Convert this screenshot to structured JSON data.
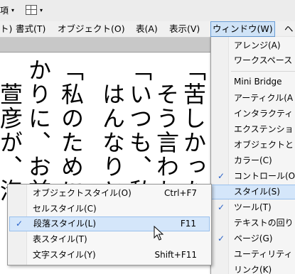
{
  "toolbar": {
    "left_glyph": "項",
    "left_caret": "▾",
    "grid_caret": "▾"
  },
  "menubar": {
    "items": [
      {
        "label": "ト)"
      },
      {
        "label": "書式(T)"
      },
      {
        "label": "オブジェクト(O)"
      },
      {
        "label": "表(A)"
      },
      {
        "label": "表示(V)"
      },
      {
        "label": "ウィンドウ(W)"
      },
      {
        "label": "ヘ"
      }
    ]
  },
  "document": {
    "columns": [
      "「苦しかった",
      "そう言われ",
      "「いつも、私の",
      "はんなりと",
      "「私のために、",
      "かりに、お前",
      "萱彦が、泡"
    ]
  },
  "window_menu": {
    "items": [
      {
        "label": "アレンジ(A)"
      },
      {
        "label": "ワークスペース"
      },
      {
        "label": "Mini Bridge"
      },
      {
        "label": "アーティクル(A"
      },
      {
        "label": "インタラクティ"
      },
      {
        "label": "エクステンショ"
      },
      {
        "label": "オブジェクトと"
      },
      {
        "label": "カラー(C)"
      },
      {
        "label": "コントロール(O"
      },
      {
        "label": "スタイル(S)"
      },
      {
        "label": "ツール(T)"
      },
      {
        "label": "テキストの回り"
      },
      {
        "label": "ページ(G)"
      },
      {
        "label": "ユーティリティ"
      },
      {
        "label": "リンク(K)"
      }
    ],
    "check_mark": "✓"
  },
  "style_submenu": {
    "items": [
      {
        "label": "オブジェクトスタイル(O)",
        "shortcut": "Ctrl+F7"
      },
      {
        "label": "セルスタイル(C)",
        "shortcut": ""
      },
      {
        "label": "段落スタイル(L)",
        "shortcut": "F11"
      },
      {
        "label": "表スタイル(T)",
        "shortcut": ""
      },
      {
        "label": "文字スタイル(Y)",
        "shortcut": "Shift+F11"
      }
    ],
    "check_mark": "✓"
  },
  "colors": {
    "highlight": "#d4e6fa",
    "highlight_border": "#99c0ec",
    "check": "#2a62c8"
  }
}
